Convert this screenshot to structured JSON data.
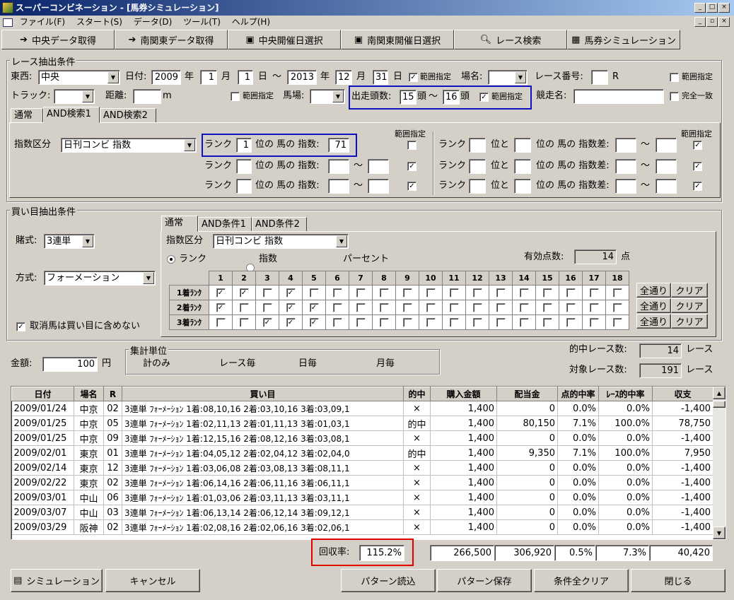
{
  "window": {
    "title": "スーパーコンビネーション - [馬券シミュレーション]"
  },
  "menu": [
    "ファイル(F)",
    "スタート(S)",
    "データ(D)",
    "ツール(T)",
    "ヘルプ(H)"
  ],
  "toolbar": [
    "中央データ取得",
    "南関東データ取得",
    "中央開催日選択",
    "南関東開催日選択",
    "レース検索",
    "馬券シミュレーション"
  ],
  "race": {
    "group_label": "レース抽出条件",
    "east_west_label": "東西:",
    "east_west": "中央",
    "date_label": "日付:",
    "from_year": "2009",
    "year_unit": "年",
    "from_month": "1",
    "month_unit": "月",
    "from_day": "1",
    "day_unit": "日",
    "tilde": "～",
    "to_year": "2013",
    "to_month": "12",
    "to_day": "31",
    "range_label": "範囲指定",
    "venue_label": "場名:",
    "raceno_label": "レース番号:",
    "r_unit": "R",
    "track_label": "トラック:",
    "distance_label": "距離:",
    "m_unit": "m",
    "baba_label": "馬場:",
    "runners_label": "出走頭数:",
    "runners_from": "15",
    "runners_unit": "頭",
    "runners_to": "16",
    "race_name_label": "競走名:",
    "exact_match_label": "完全一致",
    "tabs": [
      "通常",
      "AND検索1",
      "AND検索2"
    ],
    "index_type_label": "指数区分",
    "index_type": "日刊コンビ 指数",
    "rank_label": "ランク",
    "rank_mid": "位の 馬の 指数:",
    "rank1": "1",
    "rank1_value": "71",
    "diff_mid1": "位と",
    "diff_mid2": "位の 馬の 指数差:"
  },
  "bet": {
    "group_label": "買い目抽出条件",
    "bet_type_label": "賭式:",
    "bet_type": "3連単",
    "method_label": "方式:",
    "method": "フォーメーション",
    "exclude_label": "取消馬は買い目に含めない",
    "tabs": [
      "通常",
      "AND条件1",
      "AND条件2"
    ],
    "index_type_label": "指数区分",
    "index_type": "日刊コンビ 指数",
    "radio_rank": "ランク",
    "radio_index": "指数",
    "radio_percent": "パーセント",
    "valid_points_label": "有効点数:",
    "valid_points": "14",
    "points_unit": "点",
    "columns": [
      "1",
      "2",
      "3",
      "4",
      "5",
      "6",
      "7",
      "8",
      "9",
      "10",
      "11",
      "12",
      "13",
      "14",
      "15",
      "16",
      "17",
      "18"
    ],
    "rows": [
      {
        "label": "1着ﾗﾝｸ",
        "checked": [
          1,
          1,
          0,
          1,
          0,
          0,
          0,
          0,
          0,
          0,
          0,
          0,
          0,
          0,
          0,
          0,
          0,
          0
        ]
      },
      {
        "label": "2着ﾗﾝｸ",
        "checked": [
          1,
          0,
          0,
          1,
          1,
          0,
          0,
          0,
          0,
          0,
          0,
          0,
          0,
          0,
          0,
          0,
          0,
          0
        ]
      },
      {
        "label": "3着ﾗﾝｸ",
        "checked": [
          0,
          0,
          1,
          1,
          1,
          0,
          0,
          0,
          0,
          0,
          0,
          0,
          0,
          0,
          0,
          0,
          0,
          0
        ]
      }
    ],
    "all_btn": "全通り",
    "clear_btn": "クリア"
  },
  "summary": {
    "amount_label": "金額:",
    "amount": "100",
    "yen_unit": "円",
    "unit_group_label": "集計単位",
    "unit_total": "計のみ",
    "unit_race": "レース毎",
    "unit_day": "日毎",
    "unit_month": "月毎",
    "hit_races_label": "的中レース数:",
    "hit_races": "14",
    "race_unit": "レース",
    "target_races_label": "対象レース数:",
    "target_races": "191"
  },
  "results": {
    "headers": [
      "日付",
      "場名",
      "R",
      "買い目",
      "的中",
      "購入金額",
      "配当金",
      "点的中率",
      "ﾚｰｽ的中率",
      "収支"
    ],
    "rows": [
      [
        "2009/01/24",
        "中京",
        "02",
        "3連単 ﾌｫｰﾒｰｼｮﾝ 1着:08,10,16 2着:03,10,16 3着:03,09,1",
        "×",
        "1,400",
        "0",
        "0.0%",
        "0.0%",
        "-1,400"
      ],
      [
        "2009/01/25",
        "中京",
        "05",
        "3連単 ﾌｫｰﾒｰｼｮﾝ 1着:02,11,13 2着:01,11,13 3着:01,03,1",
        "的中",
        "1,400",
        "80,150",
        "7.1%",
        "100.0%",
        "78,750"
      ],
      [
        "2009/01/25",
        "中京",
        "09",
        "3連単 ﾌｫｰﾒｰｼｮﾝ 1着:12,15,16 2着:08,12,16 3着:03,08,1",
        "×",
        "1,400",
        "0",
        "0.0%",
        "0.0%",
        "-1,400"
      ],
      [
        "2009/02/01",
        "東京",
        "01",
        "3連単 ﾌｫｰﾒｰｼｮﾝ 1着:04,05,12 2着:02,04,12 3着:02,04,0",
        "的中",
        "1,400",
        "9,350",
        "7.1%",
        "100.0%",
        "7,950"
      ],
      [
        "2009/02/14",
        "東京",
        "12",
        "3連単 ﾌｫｰﾒｰｼｮﾝ 1着:03,06,08 2着:03,08,13 3着:08,11,1",
        "×",
        "1,400",
        "0",
        "0.0%",
        "0.0%",
        "-1,400"
      ],
      [
        "2009/02/22",
        "東京",
        "02",
        "3連単 ﾌｫｰﾒｰｼｮﾝ 1着:06,14,16 2着:06,11,16 3着:06,11,1",
        "×",
        "1,400",
        "0",
        "0.0%",
        "0.0%",
        "-1,400"
      ],
      [
        "2009/03/01",
        "中山",
        "06",
        "3連単 ﾌｫｰﾒｰｼｮﾝ 1着:01,03,06 2着:03,11,13 3着:03,11,1",
        "×",
        "1,400",
        "0",
        "0.0%",
        "0.0%",
        "-1,400"
      ],
      [
        "2009/03/07",
        "中山",
        "03",
        "3連単 ﾌｫｰﾒｰｼｮﾝ 1着:06,13,14 2着:06,12,14 3着:09,12,1",
        "×",
        "1,400",
        "0",
        "0.0%",
        "0.0%",
        "-1,400"
      ],
      [
        "2009/03/29",
        "阪神",
        "02",
        "3連単 ﾌｫｰﾒｰｼｮﾝ 1着:02,08,16 2着:02,06,16 3着:02,06,1",
        "×",
        "1,400",
        "0",
        "0.0%",
        "0.0%",
        "-1,400"
      ]
    ]
  },
  "totals": {
    "recovery_label": "回収率:",
    "recovery": "115.2%",
    "purchase": "266,500",
    "payout": "306,920",
    "point_hit": "0.5%",
    "race_hit": "7.3%",
    "balance": "40,420"
  },
  "footer": {
    "simulate": "シミュレーション",
    "cancel": "キャンセル",
    "load": "パターン読込",
    "save": "パターン保存",
    "clear_all": "条件全クリア",
    "close": "閉じる"
  }
}
